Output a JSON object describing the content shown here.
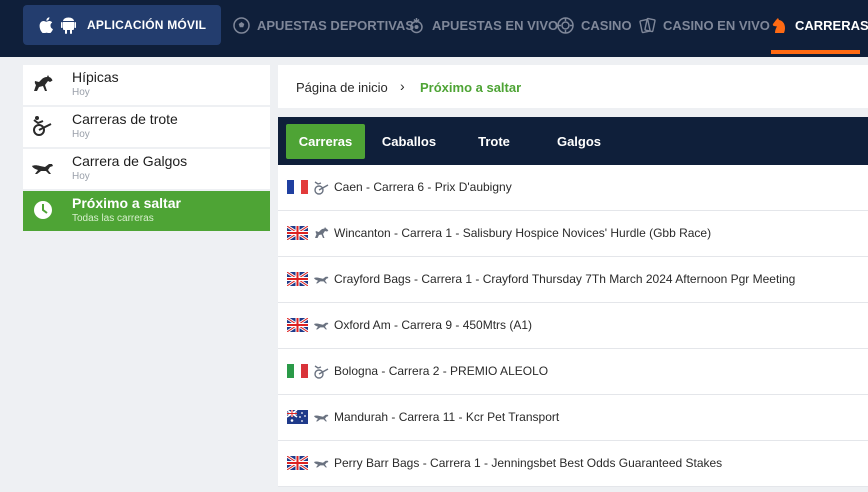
{
  "topbar": {
    "app_button_label": "APLICACIÓN MÓVIL",
    "nav": [
      {
        "label": "APUESTAS DEPORTIVAS",
        "icon": "soccer-ball-icon"
      },
      {
        "label": "APUESTAS EN VIVO",
        "icon": "live-icon"
      },
      {
        "label": "CASINO",
        "icon": "casino-chip-icon"
      },
      {
        "label": "CASINO EN VIVO",
        "icon": "cards-icon"
      },
      {
        "label": "CARRERAS",
        "icon": "horse-head-icon",
        "active": true
      }
    ],
    "accent_color": "#ff6a13"
  },
  "sidebar": {
    "items": [
      {
        "title": "Hípicas",
        "subtitle": "Hoy",
        "icon": "horse-icon"
      },
      {
        "title": "Carreras de trote",
        "subtitle": "Hoy",
        "icon": "trotting-cart-icon"
      },
      {
        "title": "Carrera de Galgos",
        "subtitle": "Hoy",
        "icon": "greyhound-icon"
      },
      {
        "title": "Próximo a saltar",
        "subtitle": "Todas las carreras",
        "icon": "clock-icon",
        "active": true
      }
    ],
    "active_color": "#4ea435"
  },
  "breadcrumb": {
    "home": "Página de inicio",
    "separator": "›",
    "current": "Próximo a saltar"
  },
  "tabs": [
    {
      "label": "Carreras",
      "active": true
    },
    {
      "label": "Caballos"
    },
    {
      "label": "Trote"
    },
    {
      "label": "Galgos"
    }
  ],
  "races": [
    {
      "flag": "france",
      "type": "trotting-cart-icon",
      "name": "Caen - Carrera 6 - Prix D'aubigny"
    },
    {
      "flag": "uk",
      "type": "horse-icon",
      "name": "Wincanton - Carrera 1 - Salisbury Hospice Novices' Hurdle (Gbb Race)"
    },
    {
      "flag": "uk",
      "type": "greyhound-icon",
      "name": "Crayford Bags - Carrera 1 - Crayford Thursday 7Th March 2024 Afternoon Pgr Meeting"
    },
    {
      "flag": "uk",
      "type": "greyhound-icon",
      "name": "Oxford Am - Carrera 9 - 450Mtrs (A1)"
    },
    {
      "flag": "italy",
      "type": "trotting-cart-icon",
      "name": "Bologna - Carrera 2 - PREMIO ALEOLO"
    },
    {
      "flag": "australia",
      "type": "greyhound-icon",
      "name": "Mandurah - Carrera 11 - Kcr Pet Transport"
    },
    {
      "flag": "uk",
      "type": "greyhound-icon",
      "name": "Perry Barr Bags - Carrera 1 - Jenningsbet Best Odds Guaranteed Stakes"
    }
  ]
}
